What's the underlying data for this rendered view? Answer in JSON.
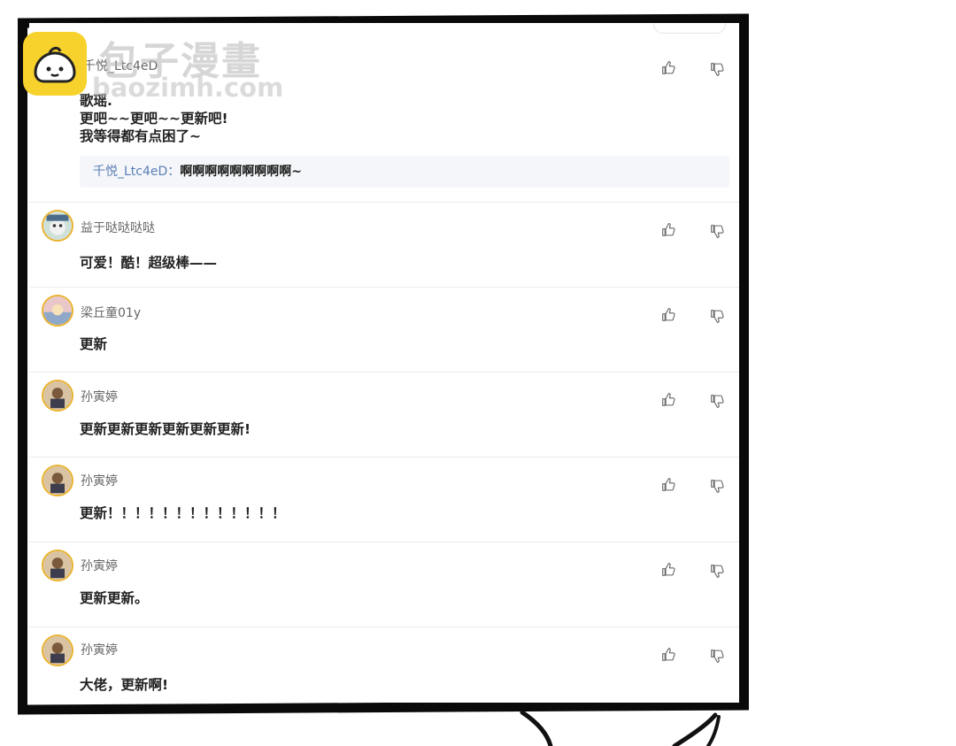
{
  "watermark": {
    "title": "包子漫畫",
    "url": "baozimh.com"
  },
  "comments": [
    {
      "username": "千悦_Ltc4eD",
      "text": "歌瑶.\n更吧~~更吧~~更新吧!\n我等得都有点困了~",
      "reply": {
        "name": "千悦_Ltc4eD",
        "sep": "：",
        "text": "啊啊啊啊啊啊啊啊啊~"
      }
    },
    {
      "username": "益于哒哒哒哒",
      "text": "可爱！酷！超级棒——"
    },
    {
      "username": "梁丘童01y",
      "text": "更新"
    },
    {
      "username": "孙寅婷",
      "text": "更新更新更新更新更新更新!"
    },
    {
      "username": "孙寅婷",
      "text": "更新！！！！！！！！！！！！！"
    },
    {
      "username": "孙寅婷",
      "text": "更新更新。"
    },
    {
      "username": "孙寅婷",
      "text": "大佬，更新啊!"
    }
  ],
  "icons": {
    "like": "thumbs-up-icon",
    "dislike": "thumbs-down-icon"
  },
  "colors": {
    "frame": "#0a0a0a",
    "reply_name": "#5b7fb7",
    "avatar_ring": "#e9b32f",
    "watermark_logo": "#f7d12c"
  }
}
